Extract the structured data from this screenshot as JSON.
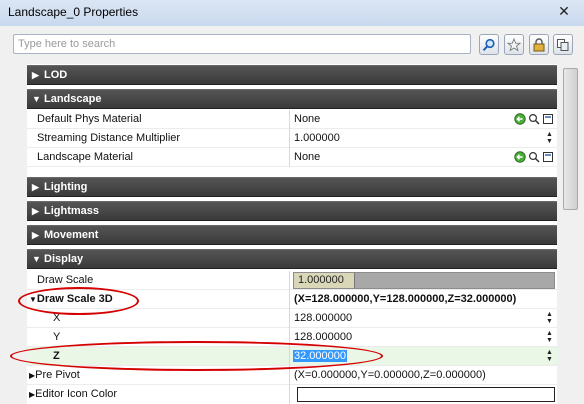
{
  "window": {
    "title": "Landscape_0 Properties",
    "close_glyph": "✕"
  },
  "search": {
    "placeholder": "Type here to search",
    "value": ""
  },
  "toolbar": {
    "icons": [
      "search-icon",
      "favorite-star-icon",
      "lock-icon",
      "copy-icon"
    ]
  },
  "sections": {
    "lod": {
      "label": "LOD",
      "expanded": false
    },
    "landscape": {
      "label": "Landscape",
      "expanded": true
    },
    "lighting": {
      "label": "Lighting",
      "expanded": false
    },
    "lightmass": {
      "label": "Lightmass",
      "expanded": false
    },
    "movement": {
      "label": "Movement",
      "expanded": false
    },
    "display": {
      "label": "Display",
      "expanded": true
    }
  },
  "landscape_props": [
    {
      "name": "Default Phys Material",
      "value": "None"
    },
    {
      "name": "Streaming Distance Multiplier",
      "value": "1.000000"
    },
    {
      "name": "Landscape Material",
      "value": "None"
    }
  ],
  "display_props": {
    "draw_scale": {
      "name": "Draw Scale",
      "value": "1.000000"
    },
    "draw_scale_3d": {
      "name": "Draw Scale 3D",
      "value": "(X=128.000000,Y=128.000000,Z=32.000000)"
    },
    "x": {
      "name": "X",
      "value": "128.000000"
    },
    "y": {
      "name": "Y",
      "value": "128.000000"
    },
    "z": {
      "name": "Z",
      "value": "32.000000"
    },
    "pre_pivot": {
      "name": "Pre Pivot",
      "value": "(X=0.000000,Y=0.000000,Z=0.000000)"
    },
    "editor_icon_color": {
      "name": "Editor Icon Color",
      "value": ""
    }
  },
  "colors": {
    "annotation": "#d40000",
    "section_bg": "#444444",
    "selection": "#3399ff"
  }
}
